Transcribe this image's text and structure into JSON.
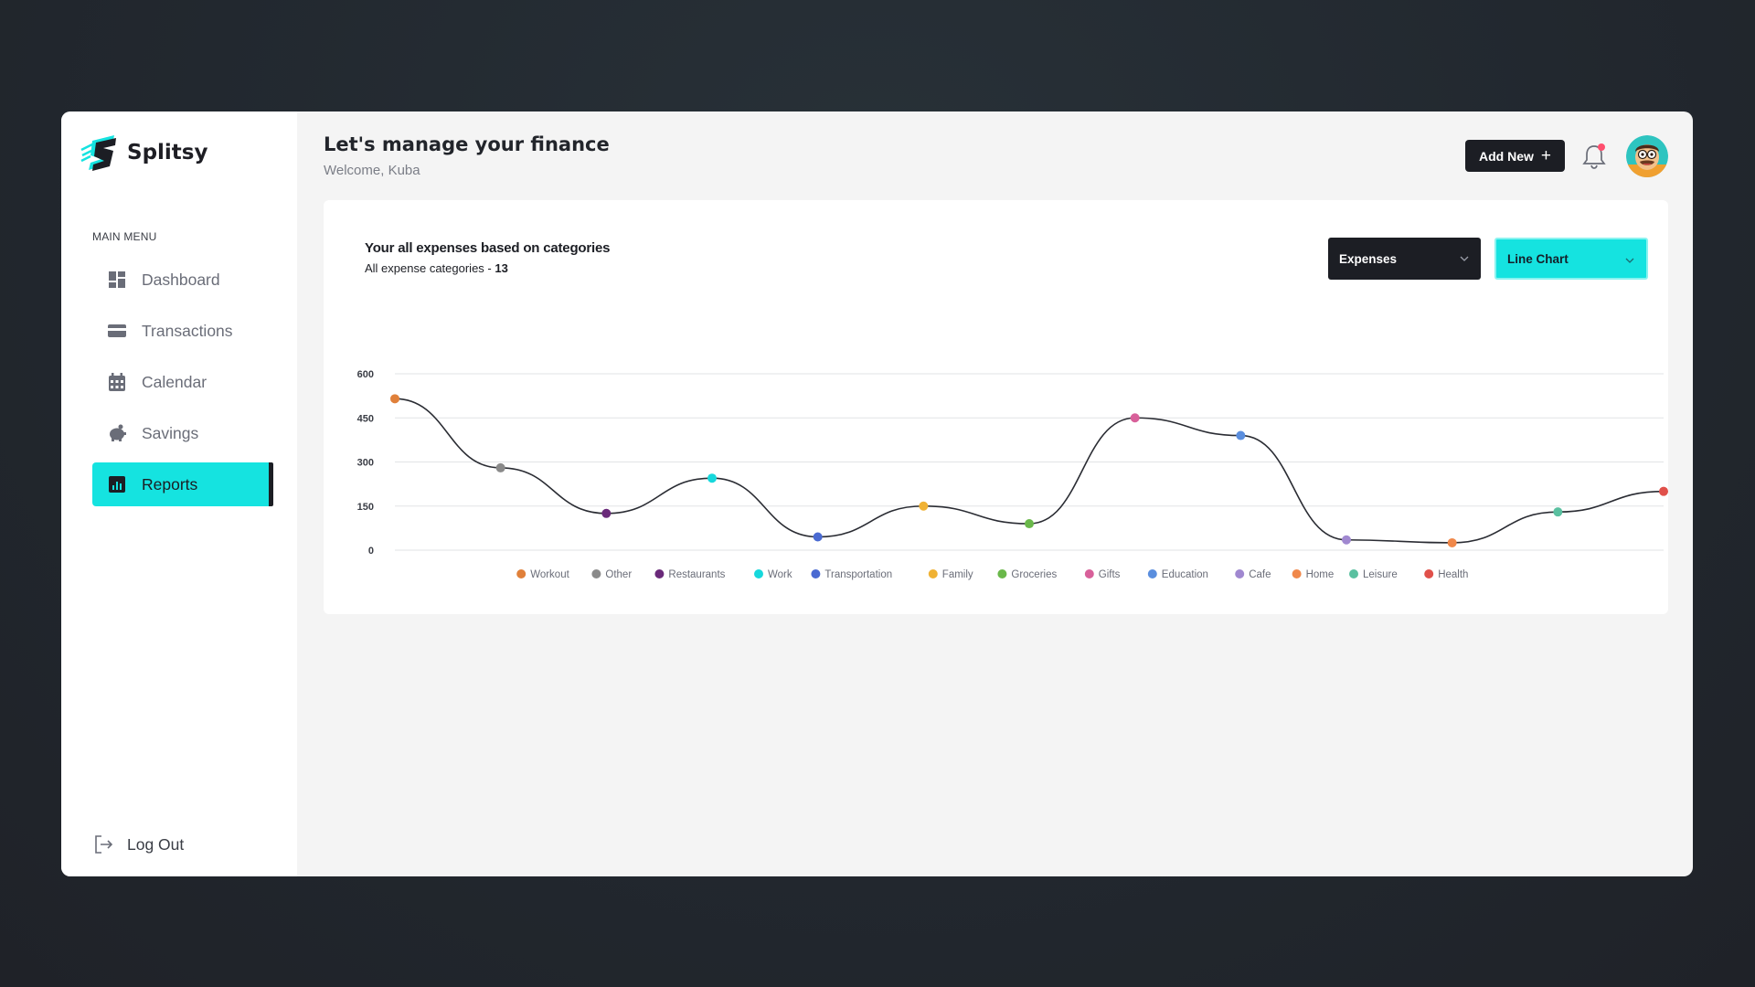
{
  "brand": {
    "name": "Splitsy"
  },
  "sidebar": {
    "heading": "MAIN MENU",
    "items": [
      {
        "label": "Dashboard",
        "icon": "dashboard-icon",
        "active": false
      },
      {
        "label": "Transactions",
        "icon": "card-icon",
        "active": false
      },
      {
        "label": "Calendar",
        "icon": "calendar-icon",
        "active": false
      },
      {
        "label": "Savings",
        "icon": "piggy-bank-icon",
        "active": false
      },
      {
        "label": "Reports",
        "icon": "chart-icon",
        "active": true
      }
    ],
    "logout_label": "Log Out"
  },
  "header": {
    "title": "Let's manage your finance",
    "subtitle": "Welcome, Kuba",
    "add_new_label": "Add New"
  },
  "card": {
    "title": "Your all expenses based on categories",
    "subtitle_prefix": "All expense categories - ",
    "subtitle_count": "13",
    "type_select": "Expenses",
    "chart_select": "Line Chart"
  },
  "colors": {
    "accent": "#15e3e0",
    "dark": "#1c1e24",
    "notification": "#ff4f6e"
  },
  "chart_data": {
    "type": "line",
    "categories": [
      "Workout",
      "Other",
      "Restaurants",
      "Work",
      "Transportation",
      "Family",
      "Groceries",
      "Gifts",
      "Education",
      "Cafe",
      "Home",
      "Leisure",
      "Health"
    ],
    "values": [
      515,
      280,
      125,
      245,
      45,
      150,
      90,
      450,
      390,
      35,
      25,
      130,
      200
    ],
    "point_colors": [
      "#e0803a",
      "#8a8a8a",
      "#6a2a7a",
      "#16d8dc",
      "#4a6ad2",
      "#f0b234",
      "#6ab84a",
      "#d8609a",
      "#5a8ede",
      "#a088d0",
      "#f0884a",
      "#5ac0a0",
      "#e0504a"
    ],
    "ylim": [
      0,
      600
    ],
    "yticks": [
      0,
      150,
      300,
      450,
      600
    ],
    "grid": true,
    "legend": "bottom",
    "smooth": true
  }
}
